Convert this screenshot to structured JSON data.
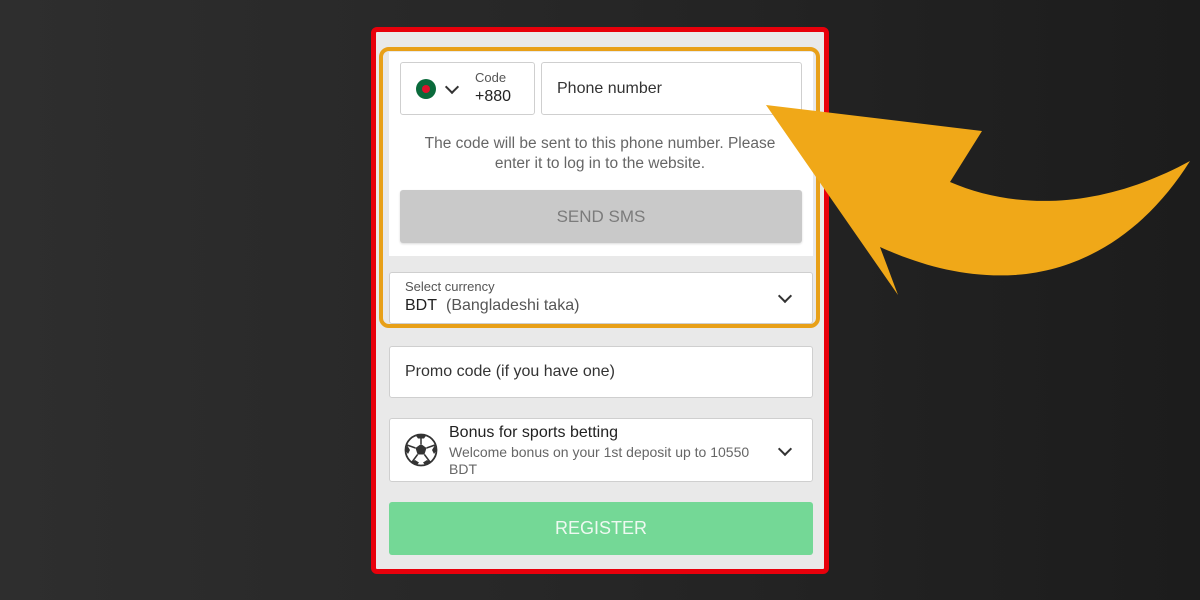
{
  "phone": {
    "code_label": "Code",
    "code_value": "+880",
    "phone_placeholder": "Phone number",
    "hint": "The code will be sent to this phone number. Please enter it to log in to the website.",
    "send_label": "SEND SMS"
  },
  "currency": {
    "label": "Select currency",
    "code": "BDT",
    "name": "(Bangladeshi taka)"
  },
  "promo": {
    "placeholder": "Promo code (if you have one)"
  },
  "bonus": {
    "title": "Bonus for sports betting",
    "description": "Welcome bonus on your 1st deposit up to 10550 BDT"
  },
  "register_label": "REGISTER",
  "colors": {
    "frame_border": "#e8000b",
    "highlight_border": "#e8a018",
    "arrow": "#f0a818",
    "register_button": "#74d896",
    "send_button": "#c9c9c9"
  },
  "icons": [
    "bangladesh-flag-icon",
    "chevron-down-icon",
    "soccer-ball-icon",
    "pointer-arrow-icon"
  ]
}
